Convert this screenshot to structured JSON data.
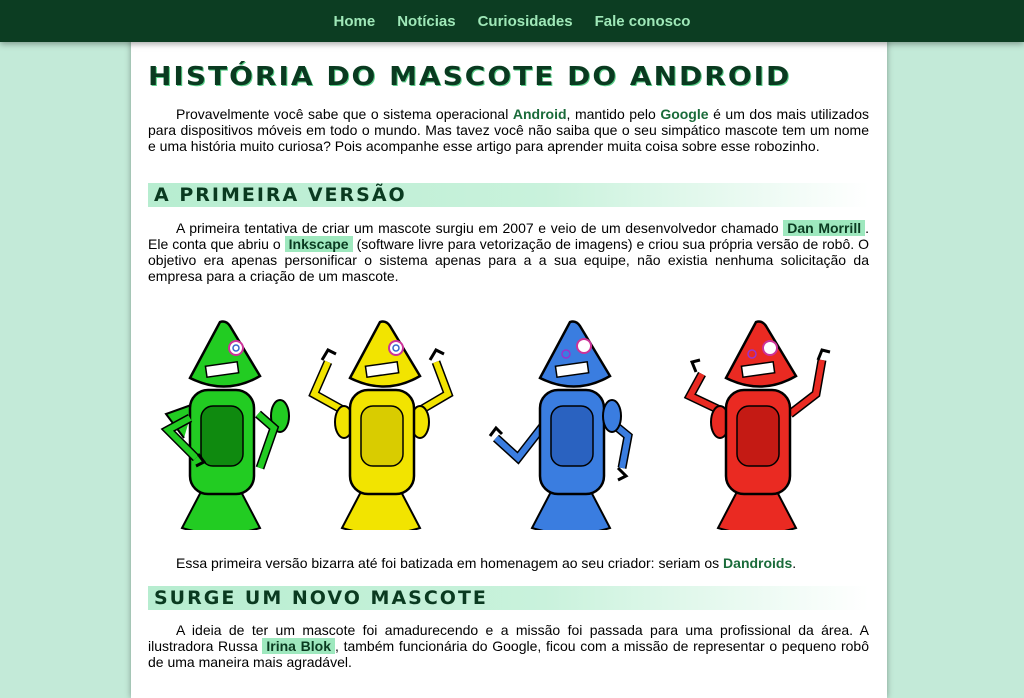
{
  "nav": [
    "Home",
    "Notícias",
    "Curiosidades",
    "Fale conosco"
  ],
  "title": "História do mascote do Android",
  "intro": {
    "t1": "Provavelmente você sabe que o sistema operacional ",
    "android": "Android",
    "t2": ", mantido pelo ",
    "google": "Google",
    "t3": " é um dos mais utilizados para dispositivos móveis em todo o mundo. Mas tavez você não saiba que o seu simpático mascote tem um nome e uma história muito curiosa? Pois acompanhe esse artigo para aprender muita coisa sobre esse robozinho."
  },
  "section1": {
    "heading": "A primeira versão",
    "t1": "A primeira tentativa de criar um mascote surgiu em 2007 e veio de um desenvolvedor chamado ",
    "dan": "Dan Morrill",
    "t2": ". Ele conta que abriu o ",
    "inkscape": "Inkscape",
    "t3": " (software livre para vetorização de imagens) e criou sua própria versão de robô. O objetivo era apenas personificar o sistema apenas para a a sua equipe, não existia nenhuma solicitação da empresa para a criação de um mascote.",
    "caption1": "Essa primeira versão bizarra até foi batizada em homenagem ao seu criador: seriam os ",
    "dandroids": "Dandroids",
    "caption2": "."
  },
  "robots": [
    {
      "color": "#22cc22",
      "dark": "#0f8a0f"
    },
    {
      "color": "#f2e400",
      "dark": "#b3a800"
    },
    {
      "color": "#3a7de0",
      "dark": "#1f4fa0"
    },
    {
      "color": "#ea2a22",
      "dark": "#a3140f"
    }
  ],
  "section2": {
    "heading": "Surge um novo mascote",
    "t1": "A ideia de ter um mascote foi amadurecendo e a missão foi passada para uma profissional da área. A ilustradora Russa ",
    "irina": "Irina Blok",
    "t2": ", também funcionária do Google, ficou com a missão de representar o pequeno robô de uma maneira mais agradável."
  }
}
